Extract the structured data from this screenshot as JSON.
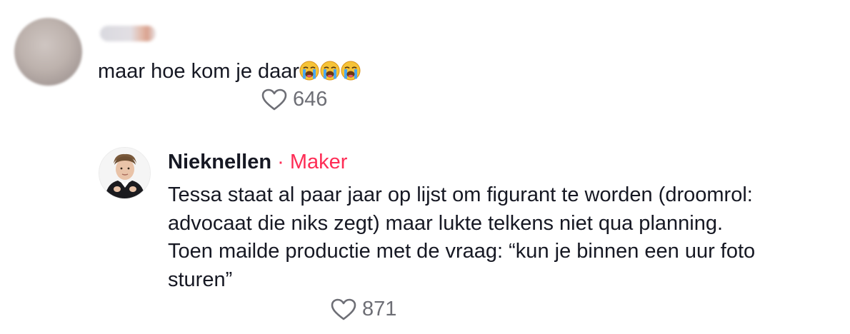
{
  "comments": [
    {
      "username": "",
      "text": "maar hoe kom je daar",
      "emojis": [
        "loudly-crying-face-icon",
        "loudly-crying-face-icon",
        "loudly-crying-face-icon"
      ],
      "likes": "646"
    }
  ],
  "reply": {
    "username": "Nieknellen",
    "separator": "·",
    "badge": "Maker",
    "lines": [
      "Tessa staat al paar jaar op lijst om figurant te worden (droomrol:",
      "advocaat die niks zegt) maar lukte telkens niet qua planning.",
      "Toen mailde productie met de vraag: “kun je binnen een uur foto",
      "sturen”"
    ],
    "likes": "871"
  },
  "colors": {
    "text": "#161823",
    "muted": "#6d6e75",
    "accent": "#fe2c55"
  }
}
